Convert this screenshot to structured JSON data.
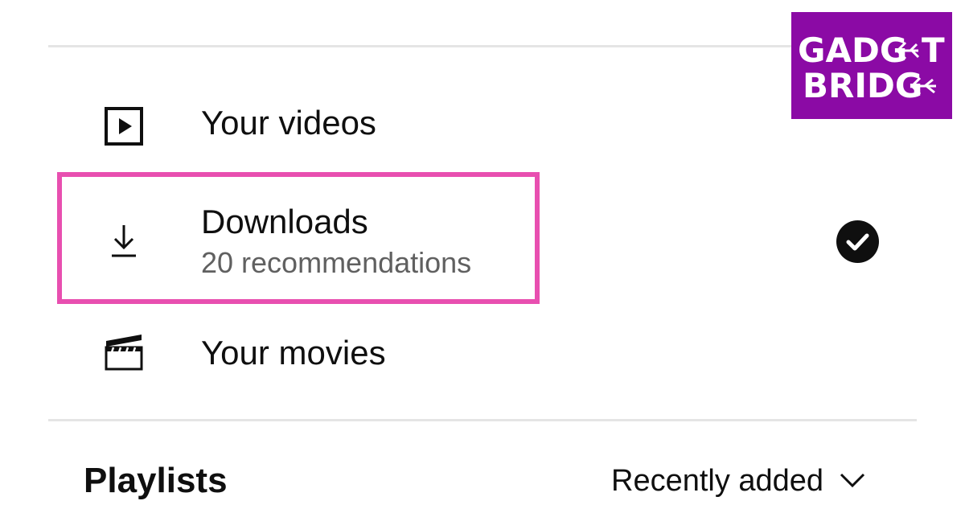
{
  "library": {
    "items": [
      {
        "label": "Your videos",
        "icon": "play-box-icon"
      },
      {
        "label": "Downloads",
        "sublabel": "20 recommendations",
        "icon": "download-icon",
        "selected_icon": "check-circle-icon"
      },
      {
        "label": "Your movies",
        "icon": "clapperboard-icon"
      }
    ]
  },
  "playlists": {
    "title": "Playlists",
    "sort_label": "Recently added",
    "sort_icon": "chevron-down-icon"
  },
  "watermark": {
    "line1": "GADG",
    "line1_end": "T",
    "line2": "BRIDG",
    "icon": "usb-arrow-icon"
  },
  "colors": {
    "highlight": "#e84fb0",
    "logo_bg": "#8b0aa5",
    "text_primary": "#0f0f0f",
    "text_secondary": "#606060"
  }
}
